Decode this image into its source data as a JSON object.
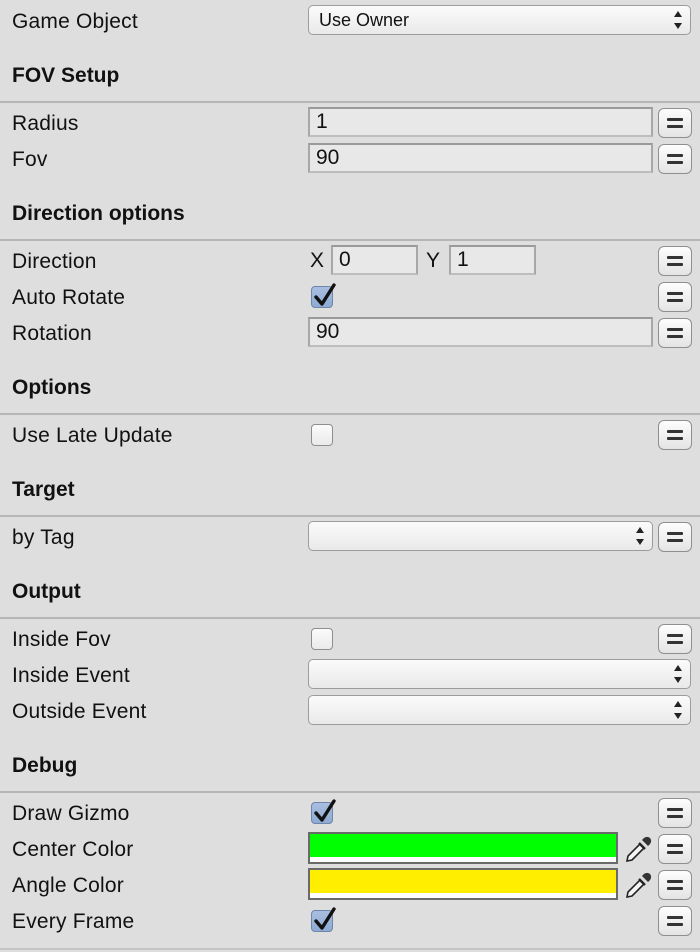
{
  "game_object": {
    "label": "Game Object",
    "value": "Use Owner"
  },
  "fov_setup": {
    "header": "FOV Setup",
    "radius": {
      "label": "Radius",
      "value": "1"
    },
    "fov": {
      "label": "Fov",
      "value": "90"
    }
  },
  "direction_options": {
    "header": "Direction options",
    "direction": {
      "label": "Direction",
      "x_label": "X",
      "x": "0",
      "y_label": "Y",
      "y": "1"
    },
    "auto_rotate": {
      "label": "Auto Rotate",
      "checked": true
    },
    "rotation": {
      "label": "Rotation",
      "value": "90"
    }
  },
  "options": {
    "header": "Options",
    "use_late_update": {
      "label": "Use Late Update",
      "checked": false
    }
  },
  "target": {
    "header": "Target",
    "by_tag": {
      "label": "by Tag",
      "value": ""
    }
  },
  "output": {
    "header": "Output",
    "inside_fov": {
      "label": "Inside Fov",
      "checked": false
    },
    "inside_event": {
      "label": "Inside Event",
      "value": ""
    },
    "outside_event": {
      "label": "Outside Event",
      "value": ""
    }
  },
  "debug": {
    "header": "Debug",
    "draw_gizmo": {
      "label": "Draw Gizmo",
      "checked": true
    },
    "center_color": {
      "label": "Center Color",
      "color": "#00ff00"
    },
    "angle_color": {
      "label": "Angle Color",
      "color": "#ffee00"
    },
    "every_frame": {
      "label": "Every Frame",
      "checked": true
    }
  },
  "icons": {
    "variable_button": "equals-icon",
    "color_picker": "eyedropper-icon",
    "checkmark": "checkmark-icon",
    "dropdown": "updown-arrows-icon"
  }
}
